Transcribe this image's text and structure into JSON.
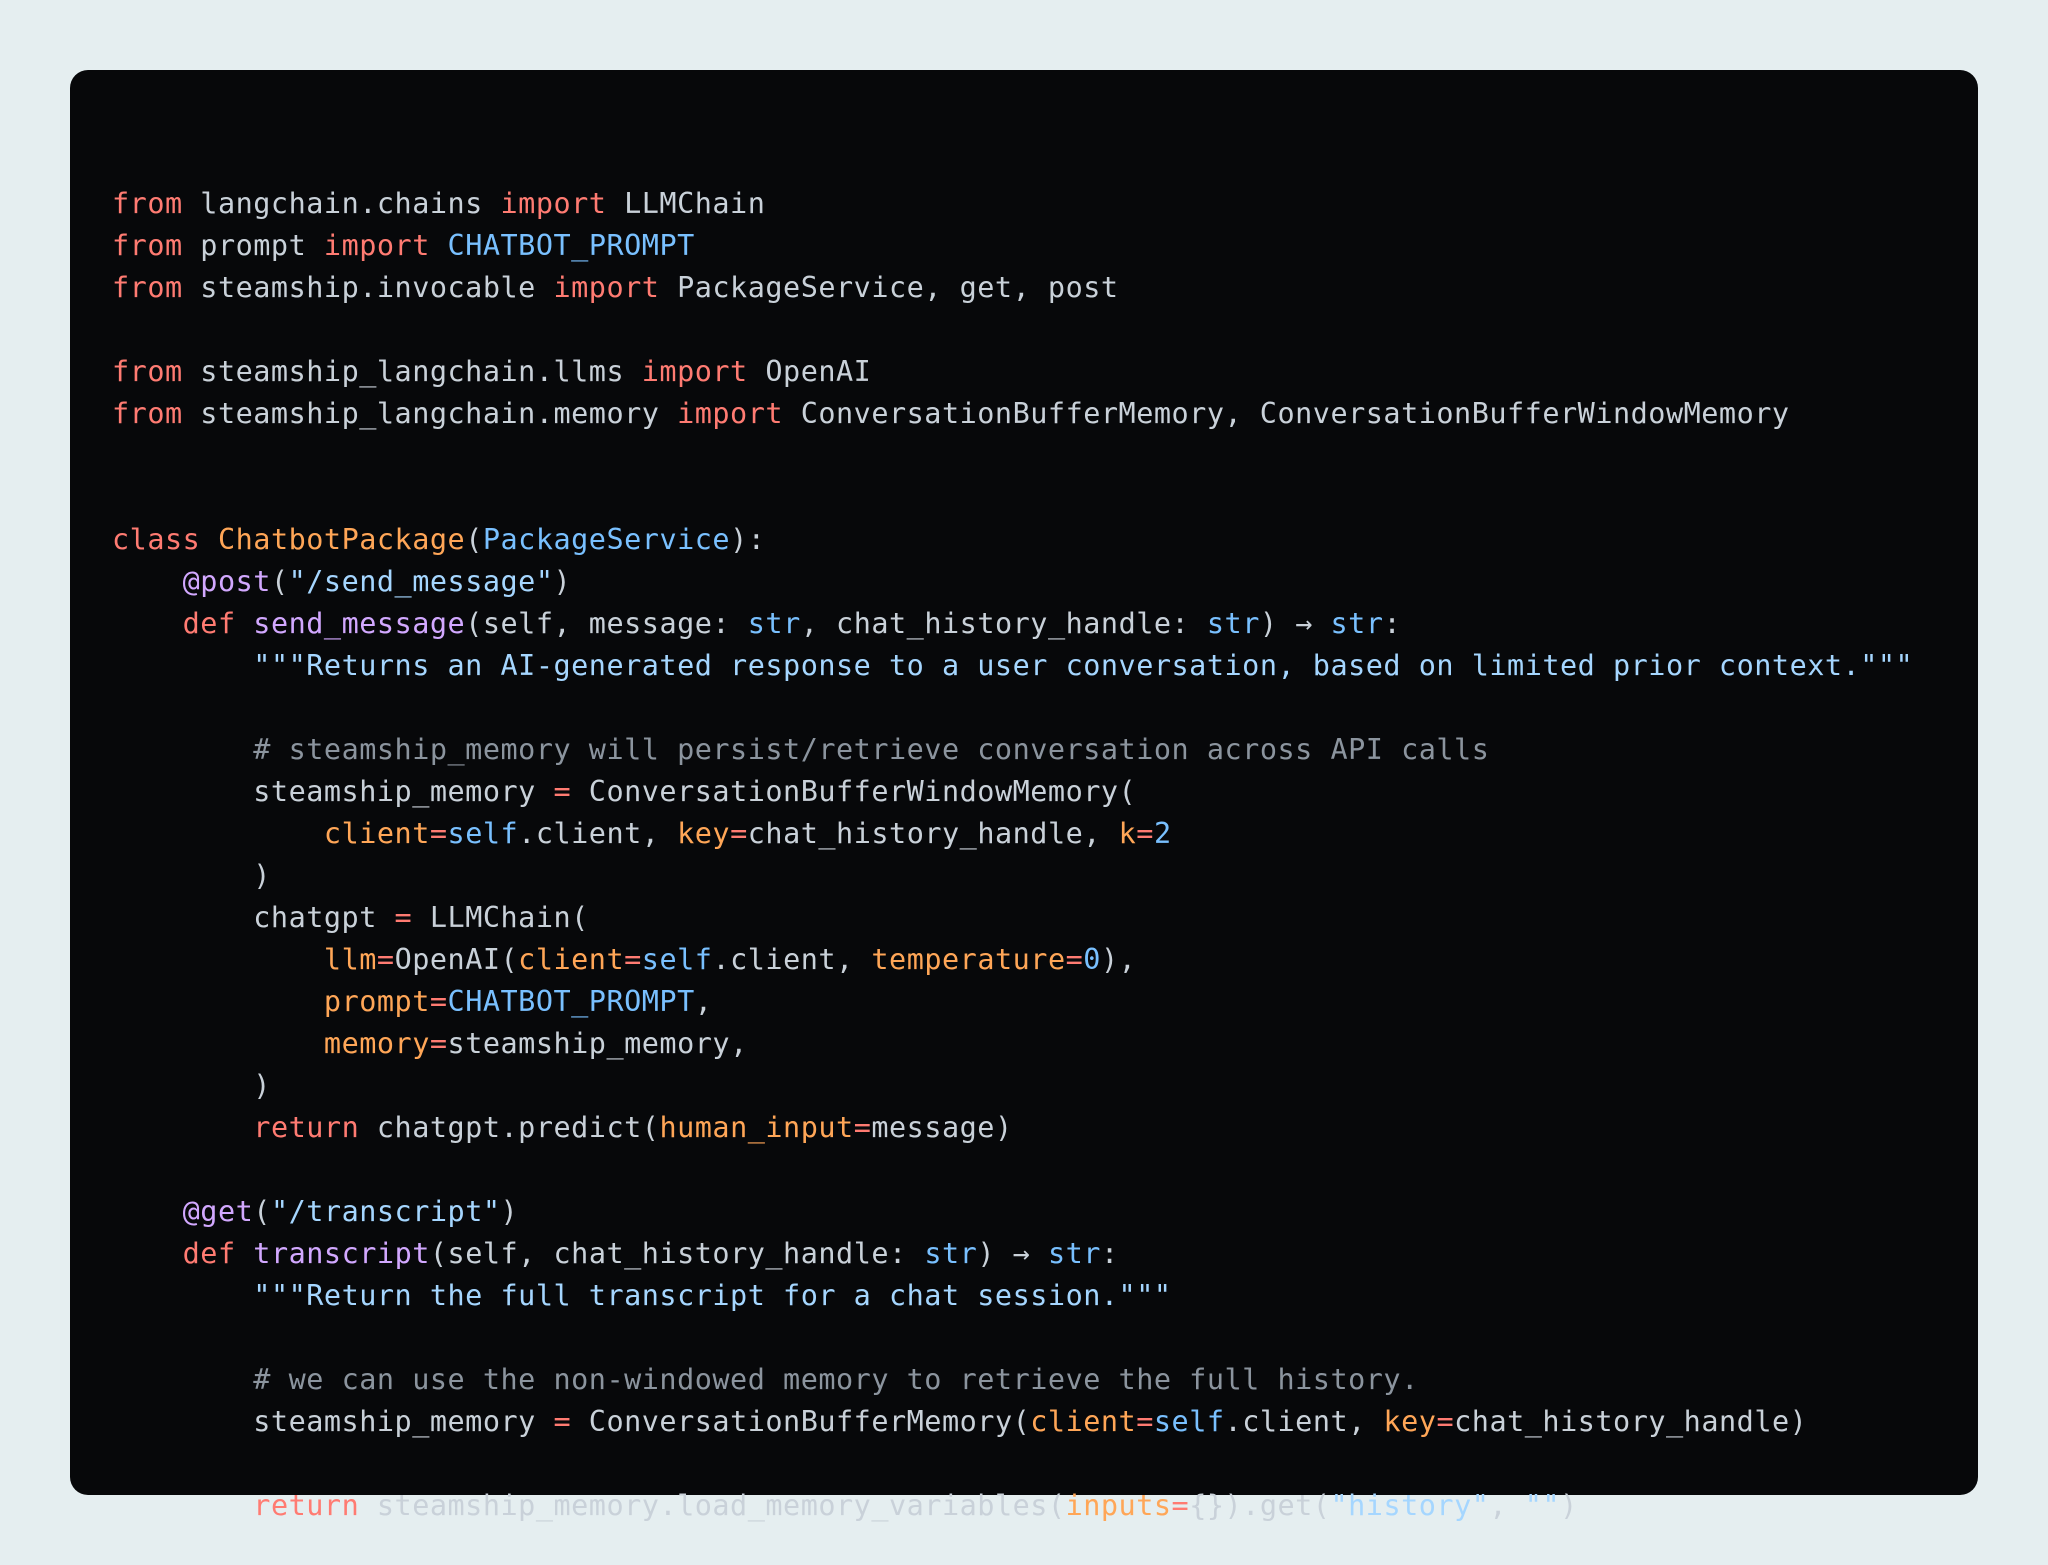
{
  "code": {
    "language": "python",
    "colors": {
      "background": "#07080a",
      "page": "#e5eef0",
      "plain": "#c9d1d9",
      "keyword": "#ff7b72",
      "builtin": "#79c0ff",
      "function": "#d2a8ff",
      "string": "#a5d6ff",
      "param": "#ffa657",
      "comment": "#8b949e"
    },
    "lines": [
      [
        [
          "kw",
          "from"
        ],
        [
          "plain",
          " langchain.chains "
        ],
        [
          "kw",
          "import"
        ],
        [
          "plain",
          " LLMChain"
        ]
      ],
      [
        [
          "kw",
          "from"
        ],
        [
          "plain",
          " prompt "
        ],
        [
          "kw",
          "import"
        ],
        [
          "plain",
          " "
        ],
        [
          "blue",
          "CHATBOT_PROMPT"
        ]
      ],
      [
        [
          "kw",
          "from"
        ],
        [
          "plain",
          " steamship.invocable "
        ],
        [
          "kw",
          "import"
        ],
        [
          "plain",
          " PackageService, get, post"
        ]
      ],
      [],
      [
        [
          "kw",
          "from"
        ],
        [
          "plain",
          " steamship_langchain.llms "
        ],
        [
          "kw",
          "import"
        ],
        [
          "plain",
          " OpenAI"
        ]
      ],
      [
        [
          "kw",
          "from"
        ],
        [
          "plain",
          " steamship_langchain.memory "
        ],
        [
          "kw",
          "import"
        ],
        [
          "plain",
          " ConversationBufferMemory, ConversationBufferWindowMemory"
        ]
      ],
      [],
      [],
      [
        [
          "kw",
          "class"
        ],
        [
          "plain",
          " "
        ],
        [
          "cls",
          "ChatbotPackage"
        ],
        [
          "plain",
          "("
        ],
        [
          "blue",
          "PackageService"
        ],
        [
          "plain",
          "):"
        ]
      ],
      [
        [
          "plain",
          "    "
        ],
        [
          "func",
          "@post"
        ],
        [
          "plain",
          "("
        ],
        [
          "str",
          "\"/send_message\""
        ],
        [
          "plain",
          ")"
        ]
      ],
      [
        [
          "plain",
          "    "
        ],
        [
          "kw",
          "def"
        ],
        [
          "plain",
          " "
        ],
        [
          "func",
          "send_message"
        ],
        [
          "plain",
          "(self, message: "
        ],
        [
          "blue",
          "str"
        ],
        [
          "plain",
          ", chat_history_handle: "
        ],
        [
          "blue",
          "str"
        ],
        [
          "plain",
          ") → "
        ],
        [
          "blue",
          "str"
        ],
        [
          "plain",
          ":"
        ]
      ],
      [
        [
          "plain",
          "        "
        ],
        [
          "str",
          "\"\"\"Returns an AI-generated response to a user conversation, based on limited prior context.\"\"\""
        ]
      ],
      [],
      [
        [
          "plain",
          "        "
        ],
        [
          "comment",
          "# steamship_memory will persist/retrieve conversation across API calls"
        ]
      ],
      [
        [
          "plain",
          "        steamship_memory "
        ],
        [
          "op",
          "="
        ],
        [
          "plain",
          " ConversationBufferWindowMemory("
        ]
      ],
      [
        [
          "plain",
          "            "
        ],
        [
          "orange",
          "client"
        ],
        [
          "op",
          "="
        ],
        [
          "blue",
          "self"
        ],
        [
          "plain",
          ".client, "
        ],
        [
          "orange",
          "key"
        ],
        [
          "op",
          "="
        ],
        [
          "plain",
          "chat_history_handle, "
        ],
        [
          "orange",
          "k"
        ],
        [
          "op",
          "="
        ],
        [
          "blue",
          "2"
        ]
      ],
      [
        [
          "plain",
          "        )"
        ]
      ],
      [
        [
          "plain",
          "        chatgpt "
        ],
        [
          "op",
          "="
        ],
        [
          "plain",
          " LLMChain("
        ]
      ],
      [
        [
          "plain",
          "            "
        ],
        [
          "orange",
          "llm"
        ],
        [
          "op",
          "="
        ],
        [
          "plain",
          "OpenAI("
        ],
        [
          "orange",
          "client"
        ],
        [
          "op",
          "="
        ],
        [
          "blue",
          "self"
        ],
        [
          "plain",
          ".client, "
        ],
        [
          "orange",
          "temperature"
        ],
        [
          "op",
          "="
        ],
        [
          "blue",
          "0"
        ],
        [
          "plain",
          "),"
        ]
      ],
      [
        [
          "plain",
          "            "
        ],
        [
          "orange",
          "prompt"
        ],
        [
          "op",
          "="
        ],
        [
          "blue",
          "CHATBOT_PROMPT"
        ],
        [
          "plain",
          ","
        ]
      ],
      [
        [
          "plain",
          "            "
        ],
        [
          "orange",
          "memory"
        ],
        [
          "op",
          "="
        ],
        [
          "plain",
          "steamship_memory,"
        ]
      ],
      [
        [
          "plain",
          "        )"
        ]
      ],
      [
        [
          "plain",
          "        "
        ],
        [
          "kw",
          "return"
        ],
        [
          "plain",
          " chatgpt.predict("
        ],
        [
          "orange",
          "human_input"
        ],
        [
          "op",
          "="
        ],
        [
          "plain",
          "message)"
        ]
      ],
      [],
      [
        [
          "plain",
          "    "
        ],
        [
          "func",
          "@get"
        ],
        [
          "plain",
          "("
        ],
        [
          "str",
          "\"/transcript\""
        ],
        [
          "plain",
          ")"
        ]
      ],
      [
        [
          "plain",
          "    "
        ],
        [
          "kw",
          "def"
        ],
        [
          "plain",
          " "
        ],
        [
          "func",
          "transcript"
        ],
        [
          "plain",
          "(self, chat_history_handle: "
        ],
        [
          "blue",
          "str"
        ],
        [
          "plain",
          ") → "
        ],
        [
          "blue",
          "str"
        ],
        [
          "plain",
          ":"
        ]
      ],
      [
        [
          "plain",
          "        "
        ],
        [
          "str",
          "\"\"\"Return the full transcript for a chat session.\"\"\""
        ]
      ],
      [],
      [
        [
          "plain",
          "        "
        ],
        [
          "comment",
          "# we can use the non-windowed memory to retrieve the full history."
        ]
      ],
      [
        [
          "plain",
          "        steamship_memory "
        ],
        [
          "op",
          "="
        ],
        [
          "plain",
          " ConversationBufferMemory("
        ],
        [
          "orange",
          "client"
        ],
        [
          "op",
          "="
        ],
        [
          "blue",
          "self"
        ],
        [
          "plain",
          ".client, "
        ],
        [
          "orange",
          "key"
        ],
        [
          "op",
          "="
        ],
        [
          "plain",
          "chat_history_handle)"
        ]
      ],
      [],
      [
        [
          "plain",
          "        "
        ],
        [
          "kw",
          "return"
        ],
        [
          "plain",
          " steamship_memory.load_memory_variables("
        ],
        [
          "orange",
          "inputs"
        ],
        [
          "op",
          "="
        ],
        [
          "plain",
          "{}).get("
        ],
        [
          "str",
          "\"history\""
        ],
        [
          "plain",
          ", "
        ],
        [
          "str",
          "\"\""
        ],
        [
          "plain",
          ")"
        ]
      ]
    ]
  }
}
